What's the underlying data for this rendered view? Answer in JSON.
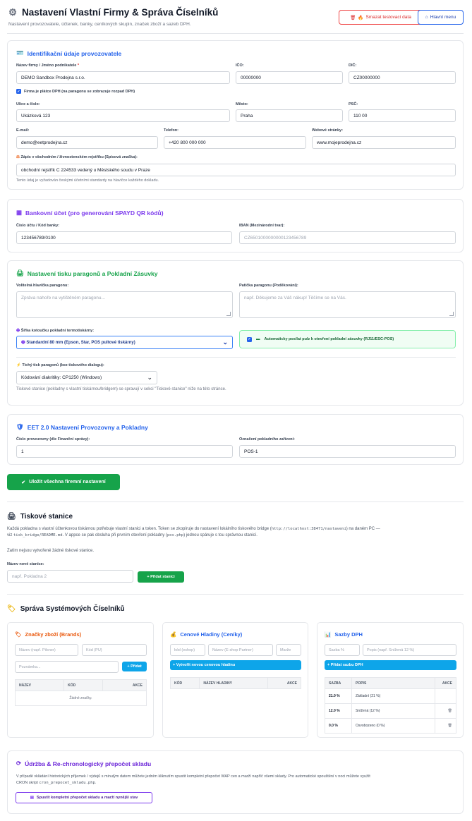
{
  "header": {
    "title": "Nastavení Vlastní Firmy & Správa Číselníků",
    "subtitle": "Nastavení provozovatele, účtenek, banky, ceníkových skupin, značek zboží a sazeb DPH.",
    "reset_button": "Smazat testovací data",
    "menu_button": "Hlavní menu"
  },
  "company": {
    "title": "Identifikační údaje provozovatele",
    "name_label": "Název firmy / Jméno podnikatele",
    "name_value": "DEMO Sandbox Prodejna s.r.o.",
    "ico_label": "IČO:",
    "ico_value": "00000000",
    "dic_label": "DIČ:",
    "dic_value": "CZ00000000",
    "vat_checkbox": "Firma je plátce DPH (na paragonu se zobrazuje rozpad DPH)",
    "street_label": "Ulice a číslo:",
    "street_value": "Ukázková 123",
    "city_label": "Město:",
    "city_value": "Praha",
    "zip_label": "PSČ:",
    "zip_value": "110 00",
    "email_label": "E-mail:",
    "email_value": "demo@eetprodejna.cz",
    "phone_label": "Telefon:",
    "phone_value": "+420 800 000 000",
    "web_label": "Webové stránky:",
    "web_value": "www.mojeprodejna.cz",
    "registry_label": "Zápis v obchodním / živnostenském rejstříku (Spisová značka):",
    "registry_value": "obchodní rejstřík C 224533 vedený u Městského soudu v Praze",
    "registry_hint": "Tento údaj je vyžadován českými účetními standardy na hlavičce každého dokladu."
  },
  "bank": {
    "title": "Bankovní účet (pro generování SPAYD QR kódů)",
    "account_label": "Číslo účtu / Kód banky:",
    "account_value": "123456789/0100",
    "iban_label": "IBAN (Mezinárodní tvar):",
    "iban_placeholder": "CZ6501000000000123456789"
  },
  "print": {
    "title": "Nastavení tisku paragonů a Pokladní Zásuvky",
    "header_label": "Volitelná hlavička paragonu:",
    "header_placeholder": "Zpráva nahoře na vytištěném paragonu...",
    "footer_label": "Patička paragonu (Poděkování):",
    "footer_placeholder": "např. Děkujeme za Váš nákup! Těšíme se na Vás.",
    "width_label": "Šířka kotoučku pokladní termotiskárny:",
    "width_value": "Standardní 80 mm (Epson, Star, POS pultové tiskárny)",
    "drawer_checkbox": "Automaticky posílat pulz k otevření pokladní zásuvky (RJ11/ESC-POS)",
    "silent_label": "Tichý tisk paragonů (bez tiskového dialogu):",
    "encoding_value": "Kódování diakritiky: CP1250 (Windows)",
    "stations_hint": "Tiskové stanice (pokladny s vlastní tiskárnou/bridgem) se spravují v sekci \"Tiskové stanice\" níže na této stránce."
  },
  "eet": {
    "title": "EET 2.0 Nastavení Provozovny a Pokladny",
    "store_label": "Číslo provozovny (dle Finanční správy):",
    "store_value": "1",
    "device_label": "Označení pokladního zařízení:",
    "device_value": "POS-1"
  },
  "save_button": "Uložit všechna firemní nastavení",
  "stations": {
    "title": "Tiskové stanice",
    "text_a": "Každá pokladna s vlastní účtenkovou tiskárnou potřebuje vlastní stanici a token. Token se zkopíruje do nastavení lokálního tiskového bridge (",
    "code_a": "http://localhost:38471/nastaveni",
    "text_b": ") na daném PC —",
    "text_c": "viz ",
    "code_b": "tisk_bridge/README.md",
    "text_d": ". V appce se pak obsluha při prvním otevření pokladny (",
    "code_c": "pos.php",
    "text_e": ") jednou spáruje s tou správnou stanicí.",
    "empty": "Zatím nejsou vytvořené žádné tiskové stanice.",
    "new_label": "Název nové stanice:",
    "new_placeholder": "např. Pokladna 2",
    "add_button": "+ Přidat stanici"
  },
  "catalogs": {
    "title": "Správa Systémových Číselníků",
    "brands": {
      "title": "Značky zboží (Brands)",
      "name_placeholder": "Název (např. Pilsner)",
      "code_placeholder": "Kód (PU)",
      "note_placeholder": "Poznámka...",
      "add_button": "+ Přidat",
      "columns": [
        "NÁZEV",
        "KÓD",
        "AKCE"
      ],
      "empty": "Žádné značky."
    },
    "pricelists": {
      "title": "Cenové Hladiny (Ceníky)",
      "code_placeholder": "kód (eshop)",
      "name_placeholder": "Název (E-shop Partner)",
      "margin_placeholder": "Marže",
      "add_button": "+ Vytvořit novou cenovou hladinu",
      "columns": [
        "KÓD",
        "NÁZEV HLADINY",
        "AKCE"
      ]
    },
    "vat": {
      "title": "Sazby DPH",
      "rate_placeholder": "Sazba %",
      "desc_placeholder": "Popis (např. Snížená 12 %)",
      "add_button": "+ Přidat sazbu DPH",
      "columns": [
        "SAZBA",
        "POPIS",
        "AKCE"
      ],
      "rows": [
        {
          "rate": "21.0 %",
          "desc": "Základní (21 %)"
        },
        {
          "rate": "12.0 %",
          "desc": "Snížená (12 %)"
        },
        {
          "rate": "0.0 %",
          "desc": "Osvobozeno (0 %)"
        }
      ]
    }
  },
  "maintenance": {
    "title": "Údržba & Re-chronologický přepočet skladu",
    "text_a": "V případě vkládání historických příjemek / výdejů s minulým datem můžete jedním kliknutím spustit kompletní přepočet WAP cen a marží napříč všemi sklady. Pro automatické spouštění v noci můžete využít",
    "text_b": "CRON skript ",
    "code": "cron_prepocet_skladu.php",
    "text_c": ".",
    "button": "Spustit kompletní přepočet skladu a marží nynější stav"
  }
}
